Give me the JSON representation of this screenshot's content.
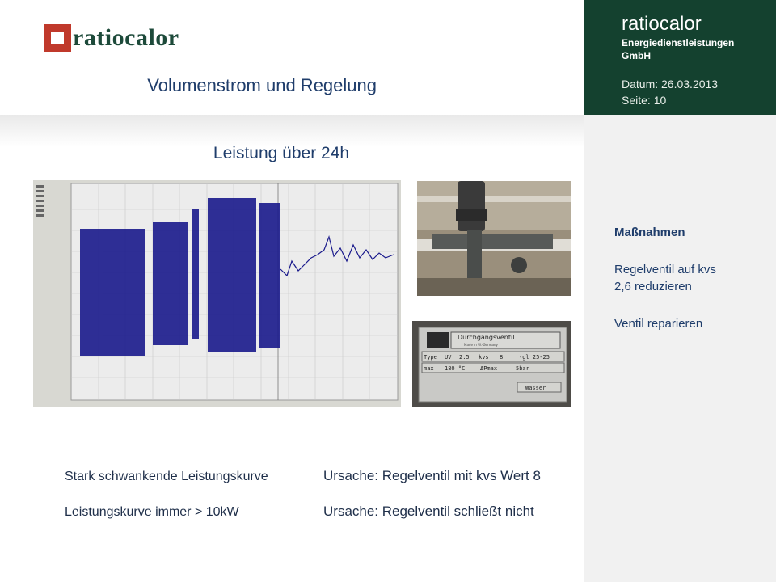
{
  "header": {
    "logo_text": "ratiocalor",
    "doc_title": "Volumenstrom und Regelung"
  },
  "company_panel": {
    "name": "ratiocalor",
    "subtitle_line1": "Energiedienstleistungen",
    "subtitle_line2": "GmbH",
    "date": "Datum: 26.03.2013",
    "page": "Seite: 10"
  },
  "slide": {
    "title": "Leistung über 24h"
  },
  "measures": {
    "title": "Maßnahmen",
    "item1_line1": "Regelventil auf kvs",
    "item1_line2": "2,6 reduzieren",
    "item2": "Ventil reparieren"
  },
  "nameplate": {
    "title": "Durchgangsventil",
    "made": "Made in W.-Germany",
    "type_label": "Type",
    "type_value": "UV",
    "type_num": "2.5",
    "kvs_label": "kvs",
    "kvs_value": "8",
    "gl": "-gl 25-25",
    "max_label": "max",
    "max_value": "180 °C",
    "dp_label": "ΔPmax",
    "dp_value": "5bar",
    "medium": "Wasser"
  },
  "bottom": {
    "left1": "Stark schwankende Leistungskurve",
    "left2": "Leistungskurve immer > 10kW",
    "right1": "Ursache: Regelventil mit kvs Wert 8",
    "right2": "Ursache: Regelventil schließt nicht"
  },
  "colors": {
    "green_panel": "#14412f",
    "title_blue": "#1f3d6b",
    "logo_red": "#c0392b",
    "curve": "#1a1a8c"
  }
}
